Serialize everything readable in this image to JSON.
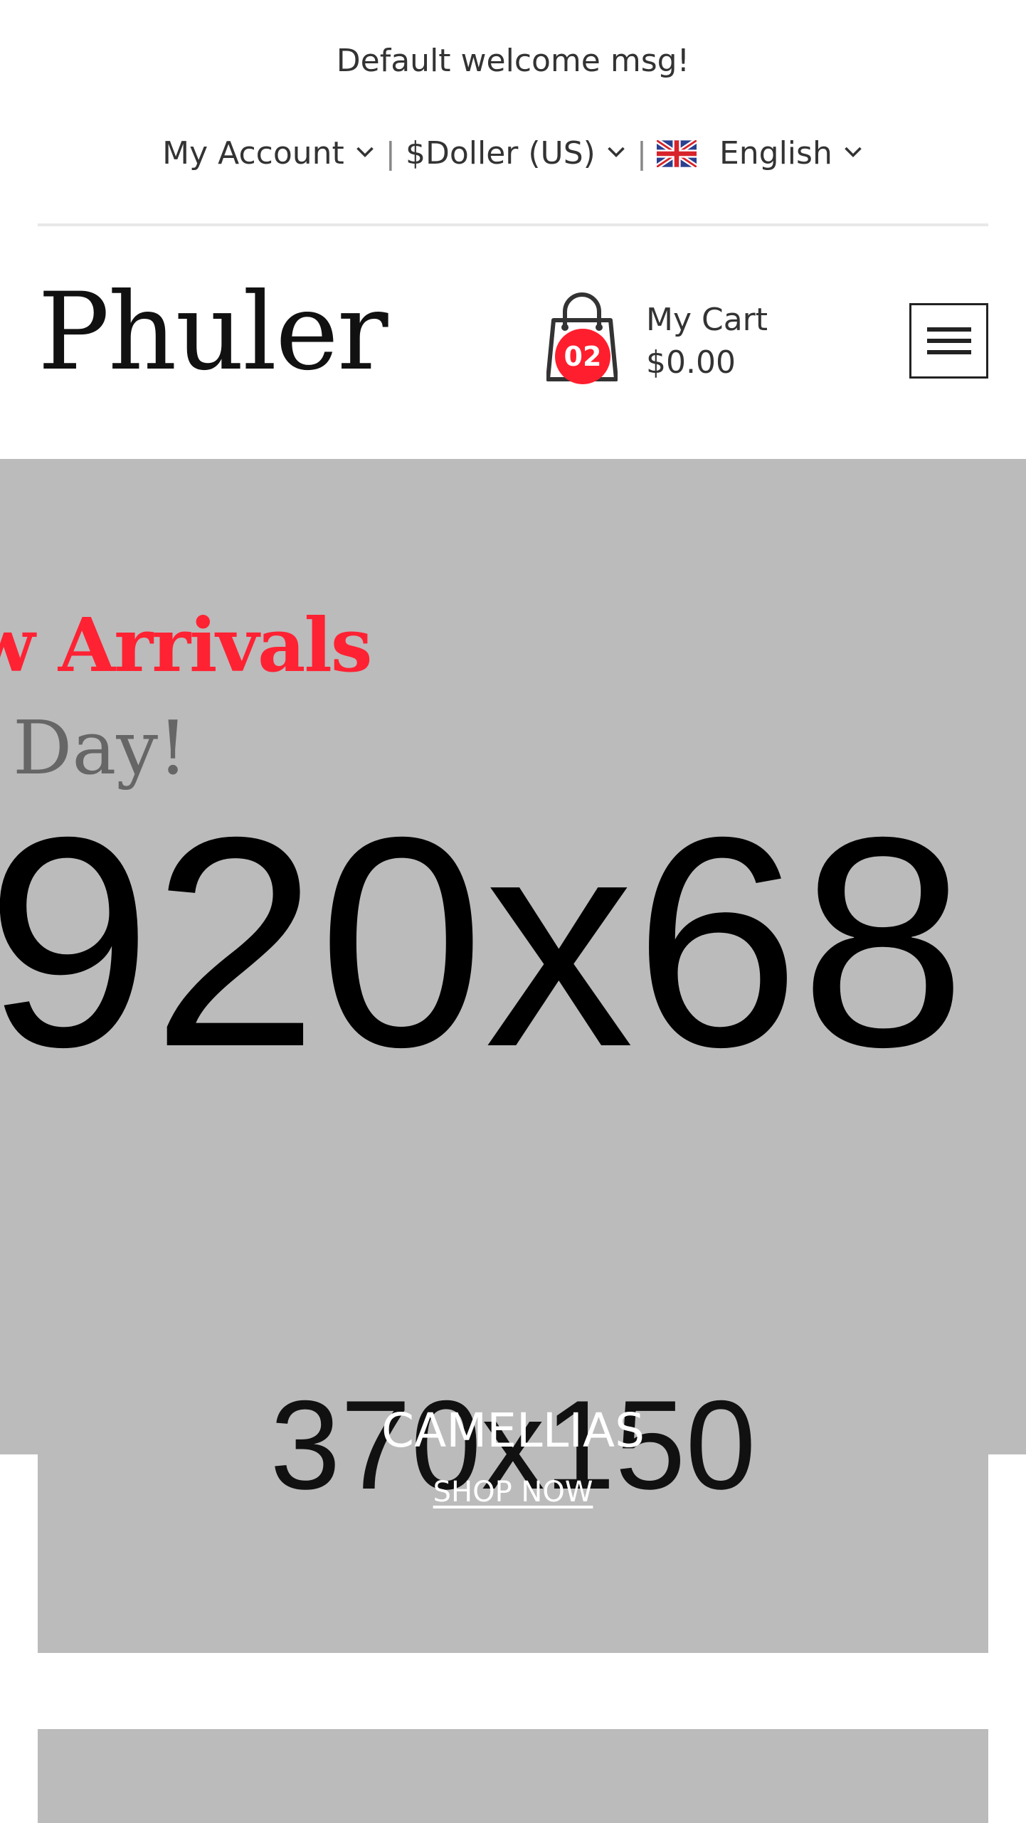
{
  "header": {
    "welcome": "Default welcome msg!",
    "account": "My Account",
    "currency": "$Doller (US)",
    "language": "English",
    "separator": "|",
    "flag_icon": "uk-flag-icon",
    "chevron_icon": "chevron-down-icon"
  },
  "brand": {
    "logo": "Phuler"
  },
  "cart": {
    "icon": "shopping-bag-icon",
    "count": "02",
    "label": "My Cart",
    "total": "$0.00"
  },
  "menu": {
    "icon": "hamburger-menu-icon"
  },
  "hero": {
    "title": "w Arrivals",
    "subtitle": "Day!",
    "placeholder": "920x68"
  },
  "banner": {
    "placeholder": "370x150",
    "title": "CAMELLIAS",
    "link": "SHOP NOW"
  },
  "colors": {
    "accent": "#ff1e2d",
    "placeholder_bg": "#bbbbbb",
    "text": "#333333"
  }
}
